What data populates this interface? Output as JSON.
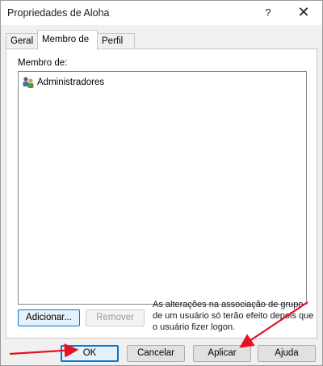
{
  "window": {
    "title": "Propriedades de Aloha",
    "help_button": "?",
    "close_button": "✕"
  },
  "tabs": [
    {
      "label": "Geral"
    },
    {
      "label": "Membro de"
    },
    {
      "label": "Perfil"
    }
  ],
  "panel": {
    "member_of_label": "Membro de:",
    "members": [
      {
        "name": "Administradores",
        "icon": "group-icon"
      }
    ],
    "add_button": "Adicionar...",
    "remove_button": "Remover",
    "note": "As alterações na associação de grupo de um usuário só terão efeito depois que o usuário fizer logon."
  },
  "footer": {
    "ok": "OK",
    "cancel": "Cancelar",
    "apply": "Aplicar",
    "help": "Ajuda"
  },
  "annotations": {
    "arrow_color": "#e81123"
  }
}
